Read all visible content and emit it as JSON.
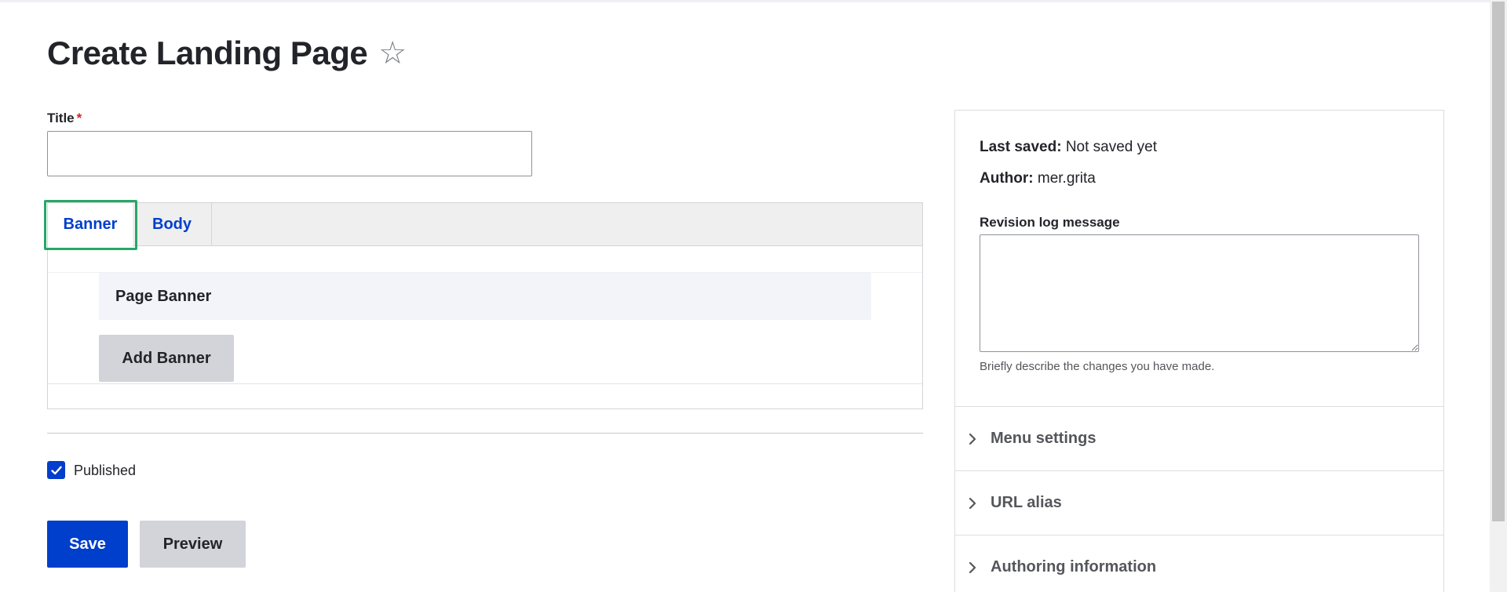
{
  "page": {
    "title": "Create Landing Page",
    "favorite_icon": "star-outline-icon"
  },
  "form": {
    "title_label": "Title",
    "title_required_marker": "*",
    "title_value": "",
    "tabs": [
      {
        "label": "Banner",
        "active": true
      },
      {
        "label": "Body",
        "active": false
      }
    ],
    "banner_panel": {
      "heading": "Page Banner",
      "add_button": "Add Banner"
    },
    "published": {
      "label": "Published",
      "checked": true
    },
    "actions": {
      "save": "Save",
      "preview": "Preview"
    }
  },
  "sidebar": {
    "last_saved_label": "Last saved:",
    "last_saved_value": "Not saved yet",
    "author_label": "Author:",
    "author_value": "mer.grita",
    "revision_label": "Revision log message",
    "revision_value": "",
    "revision_help": "Briefly describe the changes you have made.",
    "sections": [
      {
        "label": "Menu settings",
        "icon": "chevron-right-icon"
      },
      {
        "label": "URL alias",
        "icon": "chevron-right-icon"
      },
      {
        "label": "Authoring information",
        "icon": "chevron-right-icon"
      }
    ]
  },
  "colors": {
    "primary": "#003ecc",
    "focus": "#26a769",
    "required": "#d72222",
    "text": "#232429"
  }
}
